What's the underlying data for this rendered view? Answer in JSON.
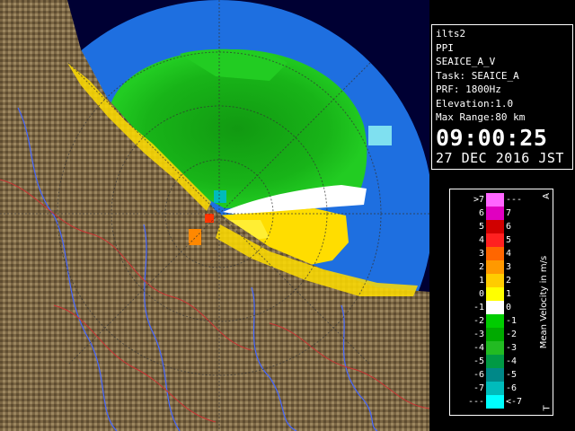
{
  "info": {
    "site": "ilts2",
    "mode": "PPI",
    "volume": "SEAICE_A_V",
    "task": "Task: SEAICE_A",
    "prf": "PRF: 1800Hz",
    "elevation": "Elevation:1.0",
    "max_range": "Max Range:80 km",
    "time": "09:00:25",
    "date": "27 DEC 2016 JST"
  },
  "legend": {
    "title": "Mean Velocity in m/s",
    "corner_top": "A",
    "corner_bottom": "T",
    "rows": [
      {
        "left": ">7",
        "right": "---",
        "color": "#ff66ff"
      },
      {
        "left": "6",
        "right": "7",
        "color": "#e000c0"
      },
      {
        "left": "5",
        "right": "6",
        "color": "#d00000"
      },
      {
        "left": "4",
        "right": "5",
        "color": "#ff2020"
      },
      {
        "left": "3",
        "right": "4",
        "color": "#ff6600"
      },
      {
        "left": "2",
        "right": "3",
        "color": "#ff9900"
      },
      {
        "left": "1",
        "right": "2",
        "color": "#ffcc00"
      },
      {
        "left": "0",
        "right": "1",
        "color": "#ffff00"
      },
      {
        "left": "-1",
        "right": "0",
        "color": "#ffffff"
      },
      {
        "left": "-2",
        "right": "-1",
        "color": "#00cc00"
      },
      {
        "left": "-3",
        "right": "-2",
        "color": "#00aa00"
      },
      {
        "left": "-4",
        "right": "-3",
        "color": "#22bb22"
      },
      {
        "left": "-5",
        "right": "-4",
        "color": "#009944"
      },
      {
        "left": "-6",
        "right": "-5",
        "color": "#008888"
      },
      {
        "left": "-7",
        "right": "-6",
        "color": "#00bbbb"
      },
      {
        "left": "---",
        "right": "<-7",
        "color": "#00ffff"
      }
    ]
  },
  "colors": {
    "sea": "#1e6fe0",
    "outside": "#000033",
    "land": "#7a6440",
    "approaching": "#00bb22",
    "receding": "#ffdd00"
  }
}
